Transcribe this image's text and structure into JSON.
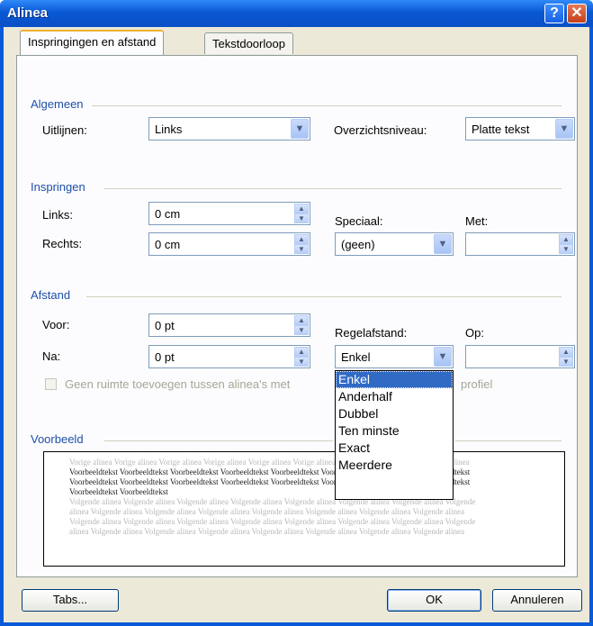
{
  "window": {
    "title": "Alinea",
    "help_icon": "?",
    "close_icon": "✕"
  },
  "tabs": [
    {
      "label": "Inspringingen en afstand",
      "active": true
    },
    {
      "label": "Tekstdoorloop",
      "active": false
    }
  ],
  "algemeen": {
    "heading": "Algemeen",
    "uitlijnen_label": "Uitlijnen:",
    "uitlijnen_value": "Links",
    "overzichtsniveau_label": "Overzichtsniveau:",
    "overzichtsniveau_value": "Platte tekst"
  },
  "inspringen": {
    "heading": "Inspringen",
    "links_label": "Links:",
    "links_value": "0 cm",
    "rechts_label": "Rechts:",
    "rechts_value": "0 cm",
    "speciaal_label": "Speciaal:",
    "speciaal_value": "(geen)",
    "met_label": "Met:",
    "met_value": ""
  },
  "afstand": {
    "heading": "Afstand",
    "voor_label": "Voor:",
    "voor_value": "0 pt",
    "na_label": "Na:",
    "na_value": "0 pt",
    "regelafstand_label": "Regelafstand:",
    "regelafstand_value": "Enkel",
    "op_label": "Op:",
    "op_value": "",
    "checkbox_label_left": "Geen ruimte toevoegen tussen alinea's met",
    "checkbox_label_right": "profiel",
    "dropdown_options": [
      "Enkel",
      "Anderhalf",
      "Dubbel",
      "Ten minste",
      "Exact",
      "Meerdere"
    ]
  },
  "voorbeeld": {
    "heading": "Voorbeeld",
    "line_prev_1": "Vorige alinea Vorige alinea Vorige alinea Vorige alinea Vorige alinea Vorige alinea Vorige alinea Vorige alinea Vorige alinea",
    "line_sample_1": "Voorbeeldtekst Voorbeeldtekst Voorbeeldtekst Voorbeeldtekst Voorbeeldtekst Voorbeeldtekst Voorbeeldtekst Voorbeeldtekst",
    "line_sample_2": "Voorbeeldtekst Voorbeeldtekst Voorbeeldtekst Voorbeeldtekst Voorbeeldtekst Voorbeeldtekst Voorbeeldtekst Voorbeeldtekst",
    "line_sample_3": "Voorbeeldtekst Voorbeeldtekst",
    "line_next_1": "Volgende alinea Volgende alinea Volgende alinea Volgende alinea Volgende alinea Volgende alinea Volgende alinea Volgende",
    "line_next_2": "alinea Volgende alinea Volgende alinea Volgende alinea Volgende alinea Volgende alinea Volgende alinea Volgende alinea",
    "line_next_3": "Volgende alinea Volgende alinea Volgende alinea Volgende alinea Volgende alinea Volgende alinea Volgende alinea Volgende",
    "line_next_4": "alinea Volgende alinea Volgende alinea Volgende alinea Volgende alinea Volgende alinea Volgende alinea Volgende alinea"
  },
  "buttons": {
    "tabs": "Tabs...",
    "ok": "OK",
    "annuleren": "Annuleren"
  }
}
